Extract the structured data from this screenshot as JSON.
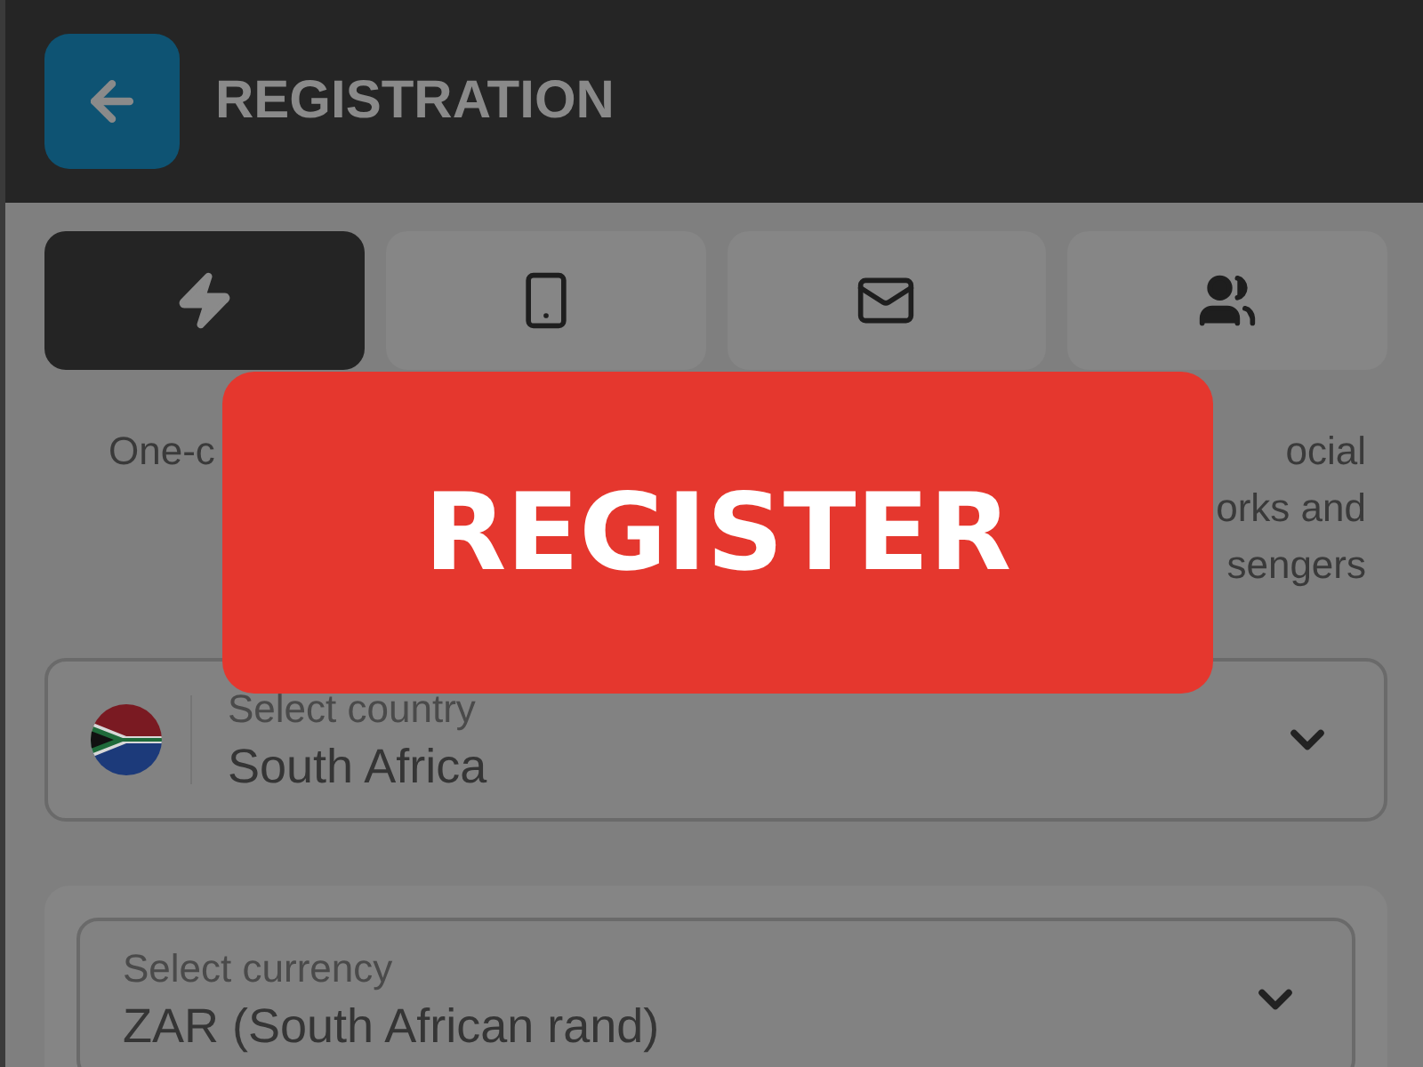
{
  "header": {
    "title": "REGISTRATION"
  },
  "methods": [
    {
      "kind": "one-click",
      "selected": true,
      "label_lines": [
        "One-c"
      ]
    },
    {
      "kind": "phone",
      "selected": false
    },
    {
      "kind": "email",
      "selected": false
    },
    {
      "kind": "social",
      "selected": false,
      "label_lines": [
        "ocial",
        "orks and",
        "sengers"
      ]
    }
  ],
  "country": {
    "label": "Select country",
    "value": "South Africa"
  },
  "currency": {
    "label": "Select currency",
    "value": "ZAR  (South African rand)"
  },
  "overlay_button": {
    "label": "REGISTER"
  }
}
